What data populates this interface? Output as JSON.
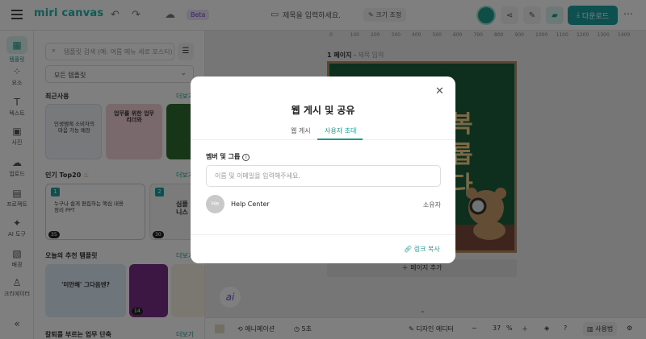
{
  "header": {
    "logo": "miri canvas",
    "beta": "Beta",
    "doc_title_placeholder": "제목을 입력하세요.",
    "resize_label": "크기 조정",
    "download_label": "다운로드"
  },
  "rail": [
    {
      "label": "템플릿",
      "icon": "template-icon"
    },
    {
      "label": "요소",
      "icon": "elements-icon"
    },
    {
      "label": "텍스트",
      "icon": "text-icon"
    },
    {
      "label": "사진",
      "icon": "photo-icon"
    },
    {
      "label": "업로드",
      "icon": "upload-icon"
    },
    {
      "label": "프로젝트",
      "icon": "project-icon"
    },
    {
      "label": "AI 도구",
      "icon": "ai-tool-icon"
    },
    {
      "label": "배경",
      "icon": "background-icon"
    },
    {
      "label": "크리에이터",
      "icon": "creator-icon"
    }
  ],
  "panel": {
    "search_placeholder": "템플릿 검색 (예: 여름 메뉴 세로 포스터)",
    "category_select": "모든 템플릿",
    "recent_title": "최근사용",
    "popular_title": "인기 Top20",
    "today_title": "오늘의 추천 템플릿",
    "calm_title": "칼퇴를 부르는 업무 단축",
    "more_label": "더보기",
    "thumb_text_1": "인생템에 소비자의 마음 가능 매장",
    "thumb_text_2": "업무를 위한 업무 리더와",
    "thumb_text_3": "누구나 쉽게 편집하는 핵심 내용정리 PPT",
    "thumb_text_4": "심플 비즈니스",
    "thumb_text_5": "'미안해' 그다음엔?",
    "popular_nums": [
      "1",
      "2"
    ],
    "chips": [
      "35",
      "30",
      "14"
    ]
  },
  "canvas": {
    "ruler_ticks": [
      "0",
      "100",
      "200",
      "300",
      "400",
      "500",
      "600",
      "700",
      "800",
      "900",
      "1000",
      "1100",
      "1200",
      "1300",
      "1400"
    ],
    "page_label": "1 페이지",
    "page_title_placeholder": "제목 입력",
    "design_chars": [
      "복",
      "롭",
      "다"
    ],
    "add_page": "페이지 추가"
  },
  "bottombar": {
    "animation": "애니메이션",
    "time": "5초",
    "design_editor": "디자인 에디터",
    "zoom": "37",
    "zoom_unit": "%",
    "help": "?",
    "guide": "사용법"
  },
  "modal": {
    "title": "웹 게시 및 공유",
    "tabs": [
      "웹 게시",
      "사용자 초대"
    ],
    "active_tab": 1,
    "member_label": "멤버 및 그룹",
    "member_placeholder": "이름 및 이메일을 입력해주세요.",
    "user": {
      "initials": "He",
      "name": "Help Center",
      "role": "소유자"
    },
    "copy_link": "링크 복사"
  },
  "colors": {
    "accent": "#1b9b8d",
    "download": "#1c9ea0",
    "beta_bg": "#ece3fb",
    "beta_text": "#7447d4",
    "design_green": "#1f5e3c"
  }
}
